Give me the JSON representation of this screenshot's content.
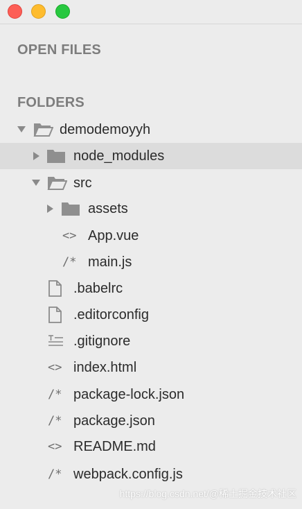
{
  "window": {
    "buttons": [
      "close",
      "minimize",
      "zoom"
    ]
  },
  "sidebar": {
    "open_files_header": "OPEN FILES",
    "folders_header": "FOLDERS",
    "items": [
      {
        "label": "demodemoyyh",
        "type": "folder",
        "expanded": true,
        "depth": 0,
        "icon": "folder-open-icon"
      },
      {
        "label": "node_modules",
        "type": "folder",
        "expanded": false,
        "depth": 1,
        "icon": "folder-icon",
        "selected": true
      },
      {
        "label": "src",
        "type": "folder",
        "expanded": true,
        "depth": 1,
        "icon": "folder-open-icon"
      },
      {
        "label": "assets",
        "type": "folder",
        "expanded": false,
        "depth": 2,
        "icon": "folder-icon"
      },
      {
        "label": "App.vue",
        "type": "file",
        "depth": 2,
        "icon": "markup-file-icon",
        "glyph": "<>"
      },
      {
        "label": "main.js",
        "type": "file",
        "depth": 2,
        "icon": "script-file-icon",
        "glyph": "/*"
      },
      {
        "label": ".babelrc",
        "type": "file",
        "depth": 1,
        "icon": "document-file-icon"
      },
      {
        "label": ".editorconfig",
        "type": "file",
        "depth": 1,
        "icon": "document-file-icon"
      },
      {
        "label": ".gitignore",
        "type": "file",
        "depth": 1,
        "icon": "text-lines-file-icon"
      },
      {
        "label": "index.html",
        "type": "file",
        "depth": 1,
        "icon": "markup-file-icon",
        "glyph": "<>"
      },
      {
        "label": "package-lock.json",
        "type": "file",
        "depth": 1,
        "icon": "script-file-icon",
        "glyph": "/*"
      },
      {
        "label": "package.json",
        "type": "file",
        "depth": 1,
        "icon": "script-file-icon",
        "glyph": "/*"
      },
      {
        "label": "README.md",
        "type": "file",
        "depth": 1,
        "icon": "markup-file-icon",
        "glyph": "<>"
      },
      {
        "label": "webpack.config.js",
        "type": "file",
        "depth": 1,
        "icon": "script-file-icon",
        "glyph": "/*"
      }
    ]
  },
  "watermark": "https://blog.csdn.net/@稀土掘金技术社区",
  "colors": {
    "sidebar_bg": "#ececec",
    "selected_row": "#dcdcdc",
    "header_text": "#7d7d7d",
    "item_text": "#2b2b2b",
    "icon": "#8a8a8a",
    "close": "#fd5e56",
    "minimize": "#febc2e",
    "zoom": "#28c840"
  }
}
